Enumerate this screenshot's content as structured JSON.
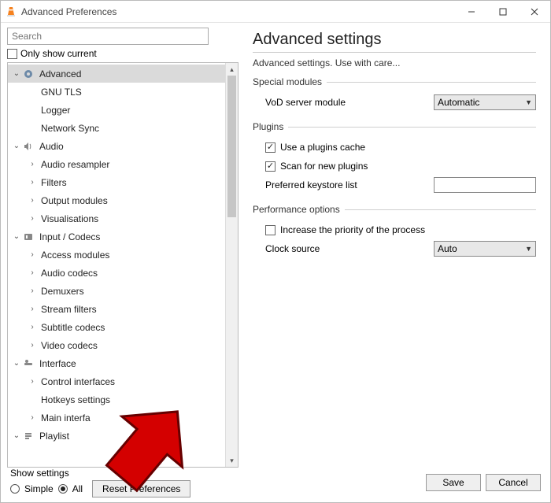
{
  "window": {
    "title": "Advanced Preferences"
  },
  "search": {
    "placeholder": "Search"
  },
  "only_show_current": "Only show current",
  "tree": {
    "advanced": "Advanced",
    "gnu_tls": "GNU TLS",
    "logger": "Logger",
    "network_sync": "Network Sync",
    "audio": "Audio",
    "audio_resampler": "Audio resampler",
    "filters": "Filters",
    "output_modules": "Output modules",
    "visualisations": "Visualisations",
    "input_codecs": "Input / Codecs",
    "access_modules": "Access modules",
    "audio_codecs": "Audio codecs",
    "demuxers": "Demuxers",
    "stream_filters": "Stream filters",
    "subtitle_codecs": "Subtitle codecs",
    "video_codecs": "Video codecs",
    "interface": "Interface",
    "control_interfaces": "Control interfaces",
    "hotkeys_settings": "Hotkeys settings",
    "main_interfaces": "Main interfa",
    "playlist": "Playlist"
  },
  "panel": {
    "heading": "Advanced settings",
    "desc": "Advanced settings. Use with care...",
    "special_modules": {
      "title": "Special modules",
      "vod_label": "VoD server module",
      "vod_value": "Automatic"
    },
    "plugins": {
      "title": "Plugins",
      "use_cache": "Use a plugins cache",
      "scan_new": "Scan for new plugins",
      "keystore_label": "Preferred keystore list"
    },
    "perf": {
      "title": "Performance options",
      "increase_priority": "Increase the priority of the process",
      "clock_label": "Clock source",
      "clock_value": "Auto"
    }
  },
  "footer": {
    "show_settings": "Show settings",
    "simple": "Simple",
    "all": "All",
    "reset": "Reset Preferences",
    "save": "Save",
    "cancel": "Cancel"
  }
}
